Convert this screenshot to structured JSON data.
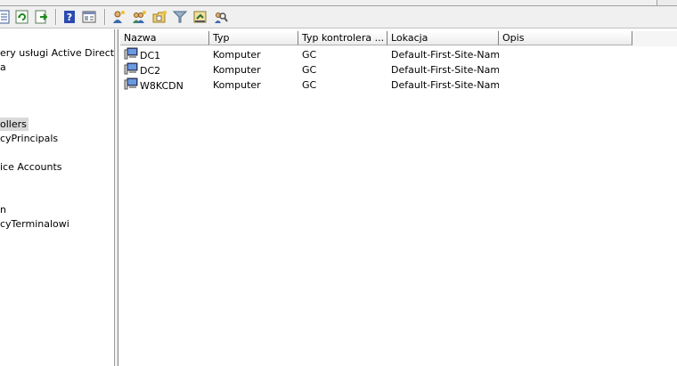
{
  "toolbar": {
    "icons": [
      "export-list-icon",
      "refresh-icon",
      "export-icon",
      "help-icon",
      "properties-icon",
      "new-user-icon",
      "new-group-icon",
      "new-ou-icon",
      "filter-icon",
      "delegate-icon",
      "find-icon"
    ]
  },
  "tree": {
    "items": [
      {
        "label": "ery usługi Active Directory"
      },
      {
        "label": "a"
      },
      {
        "label": "ollers"
      },
      {
        "label": "cyPrincipals"
      },
      {
        "label": "ice Accounts"
      },
      {
        "label": "n"
      },
      {
        "label": "cyTerminalowi"
      }
    ]
  },
  "list": {
    "columns": [
      "Nazwa",
      "Typ",
      "Typ kontrolera ...",
      "Lokacja",
      "Opis"
    ],
    "rows": [
      {
        "name": "DC1",
        "type": "Komputer",
        "dc_type": "GC",
        "site": "Default-First-Site-Name",
        "desc": ""
      },
      {
        "name": "DC2",
        "type": "Komputer",
        "dc_type": "GC",
        "site": "Default-First-Site-Name",
        "desc": ""
      },
      {
        "name": "W8KCDN",
        "type": "Komputer",
        "dc_type": "GC",
        "site": "Default-First-Site-Name",
        "desc": ""
      }
    ]
  },
  "colors": {
    "toolbar_bg": "#f0f0f0",
    "selected_bg": "#d9d9d9",
    "header_border": "#7f7f7f"
  }
}
